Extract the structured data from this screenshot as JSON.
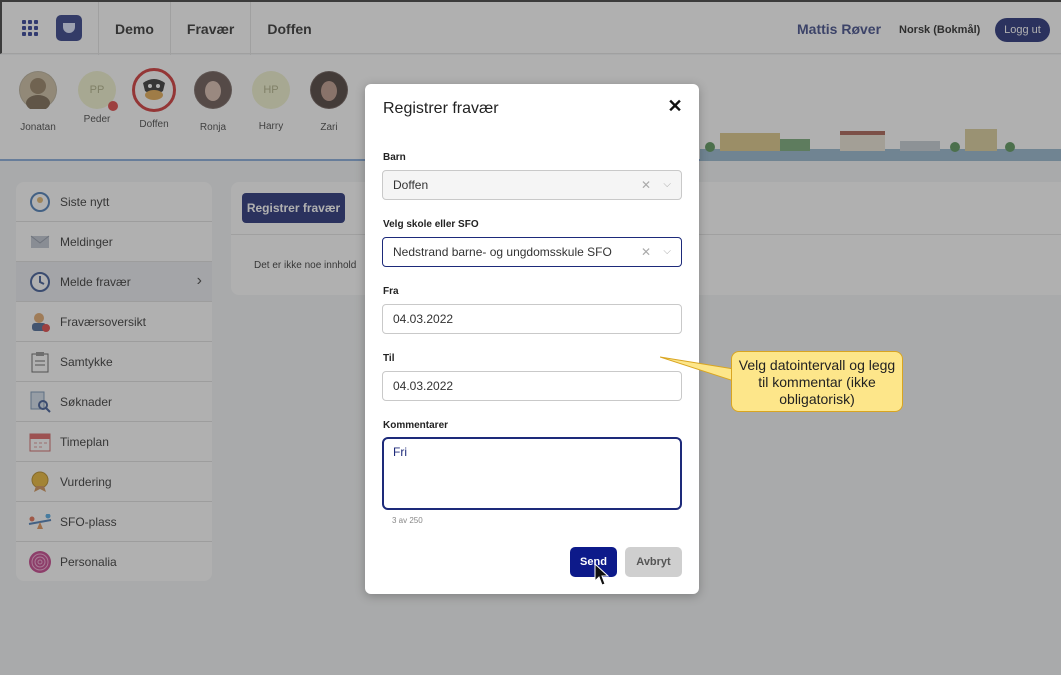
{
  "topbar": {
    "nav": [
      "Demo",
      "Fravær",
      "Doffen"
    ],
    "user": "Mattis Røver",
    "language": "Norsk (Bokmål)",
    "logout": "Logg ut"
  },
  "kids": [
    {
      "name": "Jonatan",
      "initials": "",
      "color": "#b0a590"
    },
    {
      "name": "Peder",
      "initials": "PP",
      "color": "#eef0c8"
    },
    {
      "name": "Doffen",
      "initials": "",
      "color": "#ffffff"
    },
    {
      "name": "Ronja",
      "initials": "",
      "color": "#6b5a55"
    },
    {
      "name": "Harry",
      "initials": "HP",
      "color": "#eef0c8"
    },
    {
      "name": "Zari",
      "initials": "",
      "color": "#5a4a45"
    }
  ],
  "sidebar": {
    "items": [
      {
        "label": "Siste nytt",
        "icon": "news-icon"
      },
      {
        "label": "Meldinger",
        "icon": "mail-icon"
      },
      {
        "label": "Melde fravær",
        "icon": "clock-icon"
      },
      {
        "label": "Fraværsoversikt",
        "icon": "person-absence-icon"
      },
      {
        "label": "Samtykke",
        "icon": "clipboard-icon"
      },
      {
        "label": "Søknader",
        "icon": "document-search-icon"
      },
      {
        "label": "Timeplan",
        "icon": "calendar-icon"
      },
      {
        "label": "Vurdering",
        "icon": "medal-icon"
      },
      {
        "label": "SFO-plass",
        "icon": "seesaw-icon"
      },
      {
        "label": "Personalia",
        "icon": "fingerprint-icon"
      }
    ]
  },
  "content": {
    "register_button": "Registrer fravær",
    "empty_text": "Det er ikke noe innhold"
  },
  "modal": {
    "title": "Registrer fravær",
    "close": "✕",
    "child_label": "Barn",
    "child_value": "Doffen",
    "school_label": "Velg skole eller SFO",
    "school_value": "Nedstrand barne- og ungdomsskule SFO",
    "from_label": "Fra",
    "from_value": "04.03.2022",
    "to_label": "Til",
    "to_value": "04.03.2022",
    "comment_label": "Kommentarer",
    "comment_value": "Fri",
    "counter": "3 av 250",
    "send": "Send",
    "cancel": "Avbryt"
  },
  "callout": {
    "text": "Velg datointervall og legg til kommentar (ikke obligatorisk)"
  }
}
